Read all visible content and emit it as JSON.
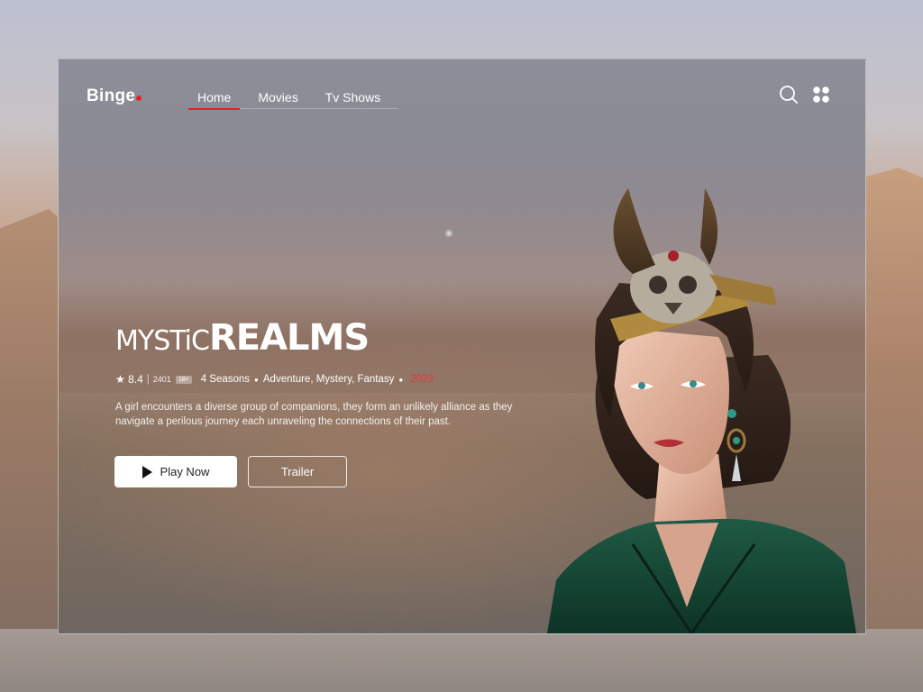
{
  "app": {
    "logo": "Binge"
  },
  "nav": {
    "items": [
      "Home",
      "Movies",
      "Tv Shows"
    ],
    "active": "Home"
  },
  "hero": {
    "title_part1": "MYSTiC",
    "title_part2": "REALMS",
    "rating": "★ 8.4",
    "votes": "2401",
    "age_badge": "18+",
    "seasons": "4 Seasons",
    "genres": "Adventure, Mystery, Fantasy",
    "year": "2023",
    "description": "A girl encounters a diverse group of companions, they form an unlikely alliance as they navigate a perilous journey  each unraveling the connections of their past.",
    "play_label": "Play Now",
    "trailer_label": "Trailer"
  },
  "colors": {
    "accent": "#e0202b",
    "year": "#e0363d",
    "text": "#ffffff"
  },
  "icons": {
    "search": "search-icon",
    "menu": "grid-menu-icon",
    "play": "play-icon"
  }
}
